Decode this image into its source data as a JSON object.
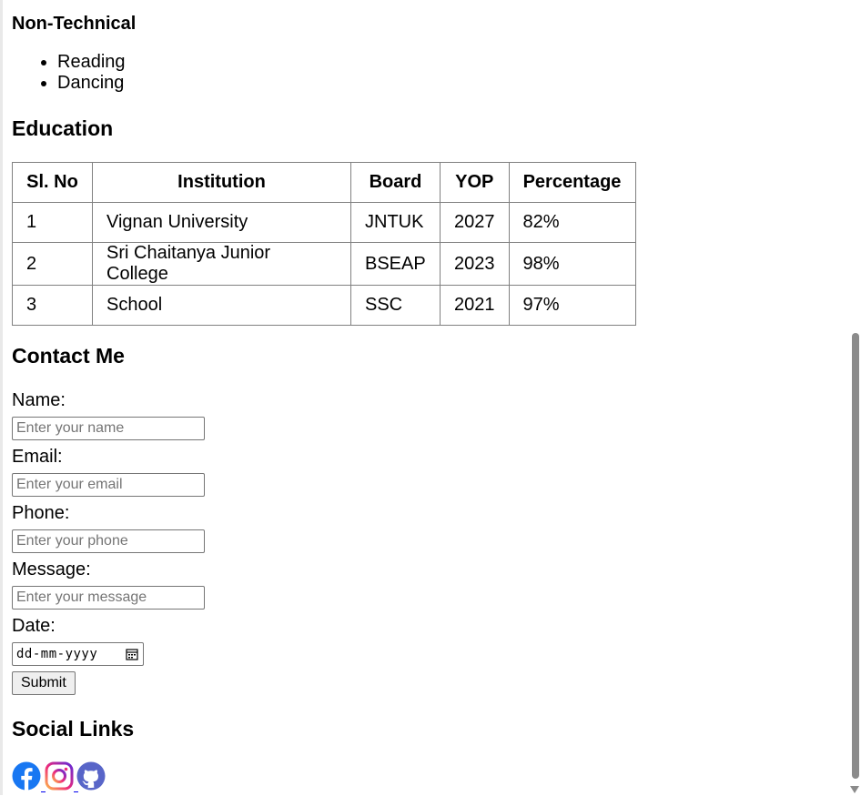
{
  "skills": {
    "non_technical_heading": "Non-Technical",
    "non_technical_items": [
      "Reading",
      "Dancing"
    ]
  },
  "education": {
    "heading": "Education",
    "columns": [
      "Sl. No",
      "Institution",
      "Board",
      "YOP",
      "Percentage"
    ],
    "rows": [
      [
        "1",
        "Vignan University",
        "JNTUK",
        "2027",
        "82%"
      ],
      [
        "2",
        "Sri Chaitanya Junior College",
        "BSEAP",
        "2023",
        "98%"
      ],
      [
        "3",
        "School",
        "SSC",
        "2021",
        "97%"
      ]
    ]
  },
  "contact": {
    "heading": "Contact Me",
    "name_label": "Name:",
    "name_placeholder": "Enter your name",
    "email_label": "Email:",
    "email_placeholder": "Enter your email",
    "phone_label": "Phone:",
    "phone_placeholder": "Enter your phone",
    "message_label": "Message:",
    "message_placeholder": "Enter your message",
    "date_label": "Date:",
    "date_placeholder": "dd-mm-yyyy",
    "submit_label": "Submit"
  },
  "social": {
    "heading": "Social Links",
    "icons": [
      "facebook-icon",
      "instagram-icon",
      "github-icon"
    ]
  },
  "colors": {
    "link": "#0000ee",
    "facebook": "#1877f2",
    "github": "#5865c8",
    "scrollbar_thumb": "#8b8b8b"
  }
}
